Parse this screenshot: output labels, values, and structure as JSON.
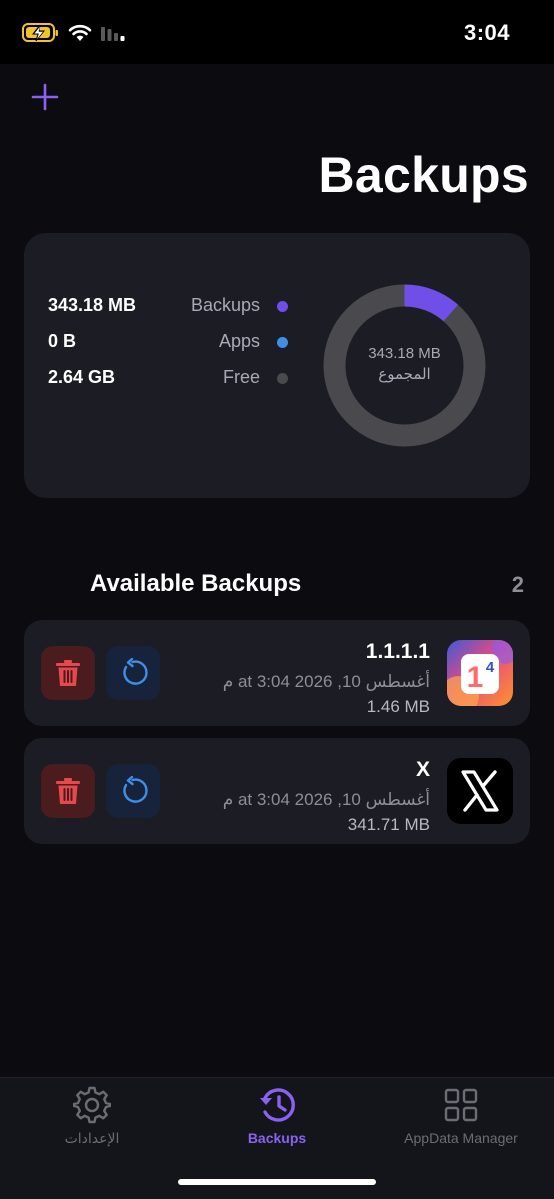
{
  "status_bar": {
    "time": "3:04"
  },
  "header": {
    "title": "Backups"
  },
  "storage": {
    "legend": [
      {
        "value": "343.18 MB",
        "label": "Backups",
        "color": "#6f4fe8"
      },
      {
        "value": "0 B",
        "label": "Apps",
        "color": "#3f8fe6"
      },
      {
        "value": "2.64 GB",
        "label": "Free",
        "color": "#4a4a4e"
      }
    ],
    "total_value": "343.18 MB",
    "total_label": "المجموع",
    "backups_fraction": 0.115
  },
  "available": {
    "title": "Available Backups",
    "count": "2"
  },
  "backups": [
    {
      "name": "1.1.1.1",
      "date": "أغسطس 10, 2026 at 3:04 م",
      "size": "1.46 MB",
      "icon": "cloudflare-1111-icon"
    },
    {
      "name": "X",
      "date": "أغسطس 10, 2026 at 3:04 م",
      "size": "341.71 MB",
      "icon": "x-app-icon"
    }
  ],
  "tabs": [
    {
      "label": "الإعدادات",
      "icon": "gear-icon",
      "active": false
    },
    {
      "label": "Backups",
      "icon": "history-clock-icon",
      "active": true
    },
    {
      "label": "AppData Manager",
      "icon": "grid-icon",
      "active": false
    }
  ],
  "colors": {
    "accent": "#8a62f0",
    "delete": "#e5484d",
    "restore": "#3f8fe6"
  }
}
